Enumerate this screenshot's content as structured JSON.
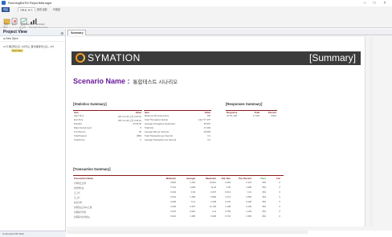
{
  "app": {
    "title": "RunningBATM ReportManager",
    "minimize": "–",
    "maximize": "□",
    "close": "×"
  },
  "ribbon": {
    "tabs": [
      "파일",
      "리포트 보기",
      "환경 설정",
      "도움말"
    ],
    "groups": [
      "결과",
      "보고서",
      "Scenario Summary"
    ],
    "buttons": [
      {
        "label": "열기",
        "icon": "open-icon"
      },
      {
        "label": "닫기",
        "icon": "close-doc-icon"
      },
      {
        "label": "요약",
        "icon": "report-icon"
      },
      {
        "label": "Scenario Summary",
        "icon": "chart-icon"
      }
    ]
  },
  "left": {
    "title": "Project View",
    "pin": "⊟",
    "toolbar": "⊞ New Open",
    "tree": [
      "⊟ ▤ 통합테스트 시나리오_결과(통합테스트)_ 1차",
      "Summary"
    ]
  },
  "doc": {
    "tab": "Summary"
  },
  "report": {
    "brand": "SYMATION",
    "banner_title": "[Summary]",
    "scenario_label": "Scenario Name :",
    "scenario_value": "통합테스트 시나리오",
    "stats": {
      "title": "[Statistics Summary]",
      "left_headers": [
        "Item",
        "Value"
      ],
      "left_rows": [
        [
          "Start Time",
          "2017-11-30 오후 3:00:51"
        ],
        [
          "End Time",
          "2017-11-30 오후 3:35:51"
        ],
        [
          "Duration",
          "00:35:00"
        ],
        [
          "Data Interval (sec)",
          "5"
        ],
        [
          "Top Percent",
          "90"
        ],
        [
          "Total Passed",
          "4884"
        ],
        [
          "Total Errors",
          "0"
        ]
      ],
      "right_headers": [
        "Item",
        "Value"
      ],
      "right_rows": [
        [
          "Maximum Running Users",
          "100"
        ],
        [
          "Total Throughput (bytes)",
          "142,777,375"
        ],
        [
          "Average Throughput (bytes/sec)",
          "25,967"
        ],
        [
          "Total Hits",
          "17,239"
        ],
        [
          "Average Hits per Second",
          "28,696"
        ],
        [
          "Total Transaction per Second",
          "0.2"
        ],
        [
          "Average Transaction per Second",
          "0.0"
        ]
      ]
    },
    "responses": {
      "title": "[Responses Summary]",
      "headers": [
        "Response",
        "Total",
        "Percent"
      ],
      "rows": [
        [
          "HTTP_200",
          "17,239",
          "100%"
        ]
      ]
    },
    "transactions": {
      "title": "[Transaction Summary]",
      "headers": [
        "Transaction Name",
        "Minimum",
        "Average",
        "Maximum",
        "Std. Dev",
        "Top Percent",
        "Pass",
        "Fail"
      ],
      "rows": [
        [
          "전체테스트에",
          "0.826",
          "1.154",
          "13.814",
          "0.393",
          "2.123",
          "681",
          "0"
        ],
        [
          "생성메인보",
          "0.701",
          "1.008",
          "11.46",
          "0.30",
          "1.938",
          "681",
          "0"
        ],
        [
          "로그인",
          "0.049",
          "0.09",
          "0.267",
          "0.013",
          "0.11",
          "681",
          "0"
        ],
        [
          "로그인",
          "0.001",
          "1.189",
          "6.809",
          "1.274",
          "1.556",
          "681",
          "0"
        ],
        [
          "통합검색",
          "0.059",
          "0.11",
          "2.248",
          "0.170",
          "0.228",
          "681",
          "0"
        ],
        [
          "상품정보조회시스템",
          "2.236",
          "3.457",
          "11.736",
          "1.108",
          "4.109",
          "681",
          "0"
        ],
        [
          "상품등록현황",
          "0.297",
          "0.991",
          "4.11",
          "0.756",
          "1.149",
          "681",
          "0"
        ],
        [
          "상품등록상세정보",
          "0.022",
          "1.185",
          "6.928",
          "0.734",
          "1.365",
          "681",
          "0"
        ]
      ]
    }
  },
  "status": {
    "text": "Connected OK  Start"
  }
}
